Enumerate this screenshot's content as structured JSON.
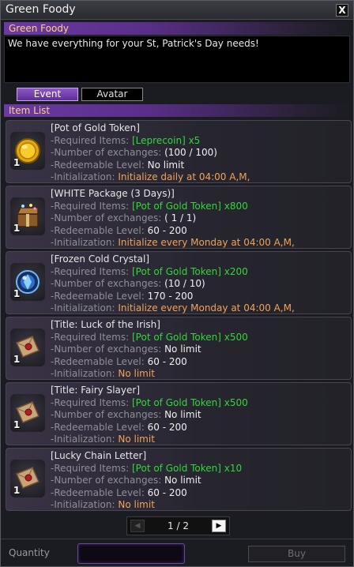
{
  "window": {
    "title": "Green Foody",
    "close_label": "X"
  },
  "npc": {
    "name": "Green Foody",
    "description": "We have everything for your St, Patrick's Day needs!"
  },
  "tabs": [
    {
      "label": "Event",
      "active": true
    },
    {
      "label": "Avatar",
      "active": false
    }
  ],
  "item_list": {
    "header": "Item List",
    "items": [
      {
        "name": "[Pot of Gold Token]",
        "icon": "gold-coin-icon",
        "qty": "1",
        "required_label": "-Required Items: ",
        "required_value": "[Leprecoin] x5",
        "exchanges_label": "-Number of exchanges: ",
        "exchanges_value": "(100 / 100)",
        "level_label": "-Redeemable Level: ",
        "level_value": "No limit",
        "init_label": "-Initialization: ",
        "init_value": "Initialize daily at 04:00 A,M,"
      },
      {
        "name": "[WHITE Package (3 Days)]",
        "icon": "treasure-box-icon",
        "qty": "1",
        "required_label": "-Required Items: ",
        "required_value": "[Pot of Gold Token] x800",
        "exchanges_label": "-Number of exchanges: ",
        "exchanges_value": "( 1 / 1)",
        "level_label": "-Redeemable Level: ",
        "level_value": "60 - 200",
        "init_label": "-Initialization: ",
        "init_value": "Initialize every Monday at 04:00 A,M,"
      },
      {
        "name": "[Frozen Cold Crystal]",
        "icon": "ice-crystal-icon",
        "qty": "1",
        "required_label": "-Required Items: ",
        "required_value": "[Pot of Gold Token] x200",
        "exchanges_label": "-Number of exchanges: ",
        "exchanges_value": "(10 / 10)",
        "level_label": "-Redeemable Level: ",
        "level_value": "170 - 200",
        "init_label": "-Initialization: ",
        "init_value": "Initialize every Monday at 04:00 A,M,"
      },
      {
        "name": "[Title: Luck of the Irish]",
        "icon": "sealed-letter-icon",
        "qty": "1",
        "required_label": "-Required Items: ",
        "required_value": "[Pot of Gold Token] x500",
        "exchanges_label": "-Number of exchanges: ",
        "exchanges_value": "No limit",
        "level_label": "-Redeemable Level: ",
        "level_value": "60 - 200",
        "init_label": "-Initialization: ",
        "init_value": "No limit"
      },
      {
        "name": "[Title: Fairy Slayer]",
        "icon": "sealed-letter-icon",
        "qty": "1",
        "required_label": "-Required Items: ",
        "required_value": "[Pot of Gold Token] x500",
        "exchanges_label": "-Number of exchanges: ",
        "exchanges_value": "No limit",
        "level_label": "-Redeemable Level: ",
        "level_value": "60 - 200",
        "init_label": "-Initialization: ",
        "init_value": "No limit"
      },
      {
        "name": "[Lucky Chain Letter]",
        "icon": "sealed-letter-icon",
        "qty": "1",
        "required_label": "-Required Items: ",
        "required_value": "[Pot of Gold Token] x10",
        "exchanges_label": "-Number of exchanges: ",
        "exchanges_value": "No limit",
        "level_label": "-Redeemable Level: ",
        "level_value": "60 - 200",
        "init_label": "-Initialization: ",
        "init_value": "No limit"
      }
    ]
  },
  "pager": {
    "text": "1 / 2",
    "prev_glyph": "◀",
    "next_glyph": "▶"
  },
  "footer": {
    "quantity_label": "Quantity",
    "quantity_value": "",
    "buy_label": "Buy"
  },
  "colors": {
    "accent_purple": "#6b3aa3",
    "required_green": "#33d63a",
    "init_orange": "#f2a25a",
    "npc_name_gold": "#ffd27a"
  }
}
